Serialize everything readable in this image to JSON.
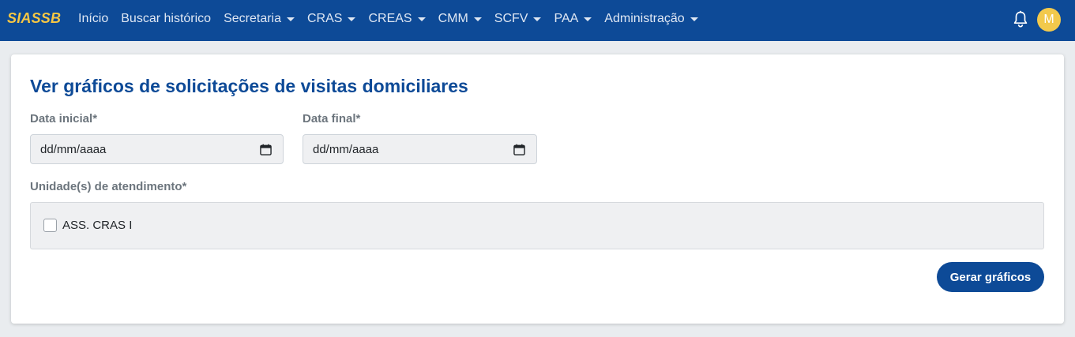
{
  "navbar": {
    "brand": "SIASSB",
    "items": [
      {
        "label": "Início",
        "dropdown": false
      },
      {
        "label": "Buscar histórico",
        "dropdown": false
      },
      {
        "label": "Secretaria",
        "dropdown": true
      },
      {
        "label": "CRAS",
        "dropdown": true
      },
      {
        "label": "CREAS",
        "dropdown": true
      },
      {
        "label": "CMM",
        "dropdown": true
      },
      {
        "label": "SCFV",
        "dropdown": true
      },
      {
        "label": "PAA",
        "dropdown": true
      },
      {
        "label": "Administração",
        "dropdown": true
      }
    ],
    "avatar_initial": "M",
    "colors": {
      "navbar_bg": "#0d4a97",
      "brand": "#f6c744",
      "avatar_bg": "#f2c94c"
    }
  },
  "main": {
    "title": "Ver gráficos de solicitações de visitas domiciliares",
    "start_date": {
      "label": "Data inicial*",
      "placeholder": "dd/mm/aaaa"
    },
    "end_date": {
      "label": "Data final*",
      "placeholder": "dd/mm/aaaa"
    },
    "units": {
      "label": "Unidade(s) de atendimento*",
      "options": [
        {
          "label": "ASS. CRAS I",
          "checked": false
        }
      ]
    },
    "submit_label": "Gerar gráficos"
  },
  "icons": {
    "notifications": "bell-icon",
    "date_picker": "calendar-icon"
  }
}
